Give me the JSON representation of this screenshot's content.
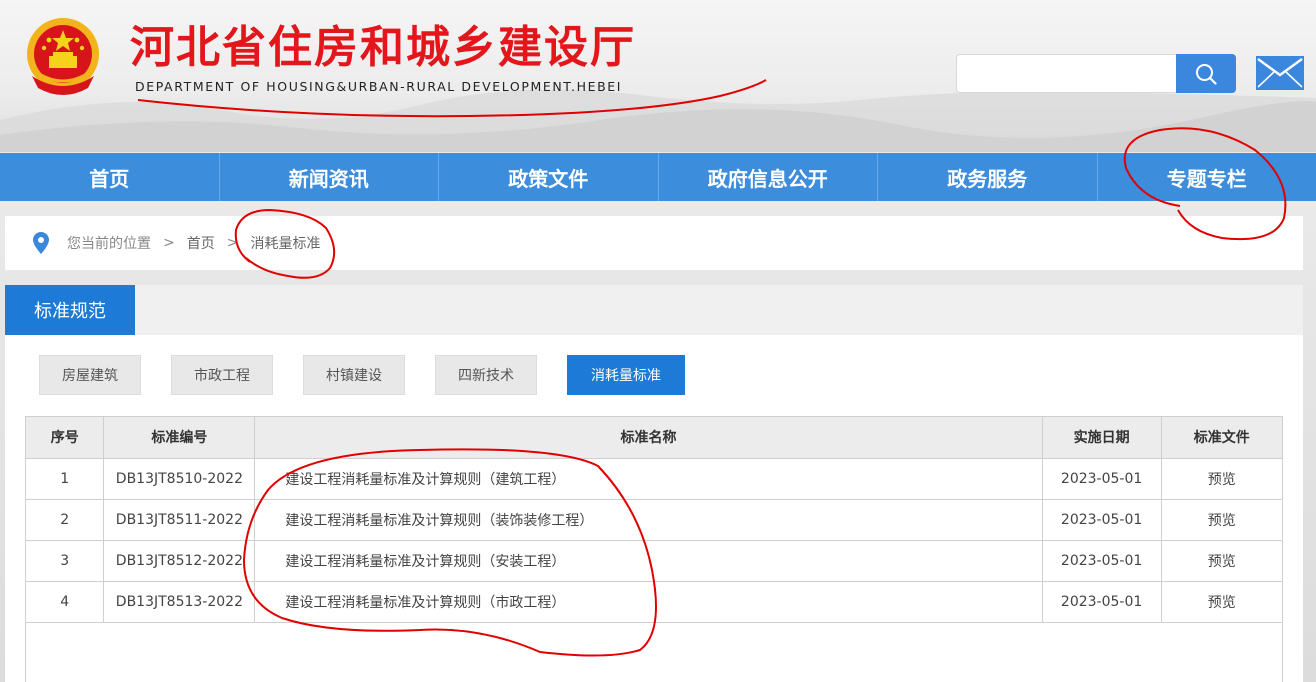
{
  "header": {
    "title": "河北省住房和城乡建设厅",
    "subtitle": "DEPARTMENT OF HOUSING&URBAN-RURAL DEVELOPMENT.HEBEI",
    "search_placeholder": "",
    "search_icon": "search-icon",
    "mail_icon": "mail-icon"
  },
  "nav": {
    "items": [
      {
        "label": "首页"
      },
      {
        "label": "新闻资讯"
      },
      {
        "label": "政策文件"
      },
      {
        "label": "政府信息公开"
      },
      {
        "label": "政务服务"
      },
      {
        "label": "专题专栏"
      }
    ]
  },
  "breadcrumb": {
    "prefix": "您当前的位置",
    "sep": ">",
    "items": [
      "首页",
      "消耗量标准"
    ]
  },
  "panel": {
    "tab_label": "标准规范",
    "subtabs": [
      "房屋建筑",
      "市政工程",
      "村镇建设",
      "四新技术",
      "消耗量标准"
    ],
    "active_subtab": "消耗量标准"
  },
  "table": {
    "headers": [
      "序号",
      "标准编号",
      "标准名称",
      "实施日期",
      "标准文件"
    ],
    "rows": [
      [
        "1",
        "DB13JT8510-2022",
        "建设工程消耗量标准及计算规则（建筑工程）",
        "2023-05-01",
        "预览"
      ],
      [
        "2",
        "DB13JT8511-2022",
        "建设工程消耗量标准及计算规则（装饰装修工程）",
        "2023-05-01",
        "预览"
      ],
      [
        "3",
        "DB13JT8512-2022",
        "建设工程消耗量标准及计算规则（安装工程）",
        "2023-05-01",
        "预览"
      ],
      [
        "4",
        "DB13JT8513-2022",
        "建设工程消耗量标准及计算规则（市政工程）",
        "2023-05-01",
        "预览"
      ]
    ]
  },
  "colors": {
    "brand_red": "#e3161b",
    "nav_blue": "#3c8ddc",
    "active_blue": "#1d7ad6",
    "annotation_red": "#e00000"
  }
}
